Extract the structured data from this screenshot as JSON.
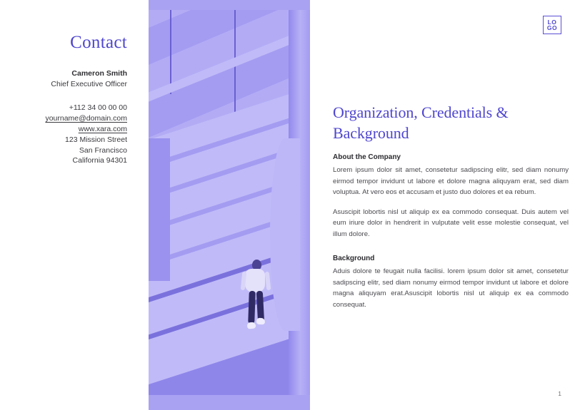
{
  "document": {
    "page_number": "1",
    "accent_color": "#4f46cf",
    "image_tint_color": "#9b93ef"
  },
  "logo": {
    "name": "logo-mark",
    "line1": "LO",
    "line2": "GO"
  },
  "contact": {
    "title": "Contact",
    "person_name": "Cameron Smith",
    "person_role": "Chief Executive Officer",
    "details": [
      {
        "text": "+112 34 00 00 00",
        "link": false,
        "name": "contact-phone"
      },
      {
        "text": "yourname@domain.com",
        "link": true,
        "name": "contact-email"
      },
      {
        "text": "www.xara.com",
        "link": true,
        "name": "contact-website"
      },
      {
        "text": "123 Mission Street",
        "link": false,
        "name": "contact-street"
      },
      {
        "text": "San Francisco",
        "link": false,
        "name": "contact-city"
      },
      {
        "text": "California 94301",
        "link": false,
        "name": "contact-state-zip"
      }
    ]
  },
  "photo": {
    "alt": "Person in white shirt and dark trousers walking down a wide staircase, duotone purple",
    "name": "staircase-photo"
  },
  "main": {
    "heading": "Organization, Credentials & Background",
    "sections": [
      {
        "subheading": "About the Company",
        "paragraphs": [
          "Lorem ipsum dolor sit amet, consetetur sadipscing elitr, sed diam nonumy eirmod tempor invidunt ut labore et dolore magna aliquyam erat, sed diam voluptua. At vero eos et accusam et justo duo dolores et ea rebum.",
          "Asuscipit lobortis nisl ut aliquip ex ea commodo consequat. Duis autem vel eum iriure dolor in hendrerit in vulputate velit esse molestie consequat, vel illum dolore."
        ]
      },
      {
        "subheading": "Background",
        "paragraphs": [
          "Aduis dolore te feugait nulla facilisi. lorem ipsum dolor sit amet, consetetur sadipscing elitr, sed diam nonumy eirmod tempor invidunt ut labore et dolore magna aliquyam erat.Asuscipit lobortis nisl ut aliquip ex ea commodo consequat."
        ]
      }
    ]
  }
}
